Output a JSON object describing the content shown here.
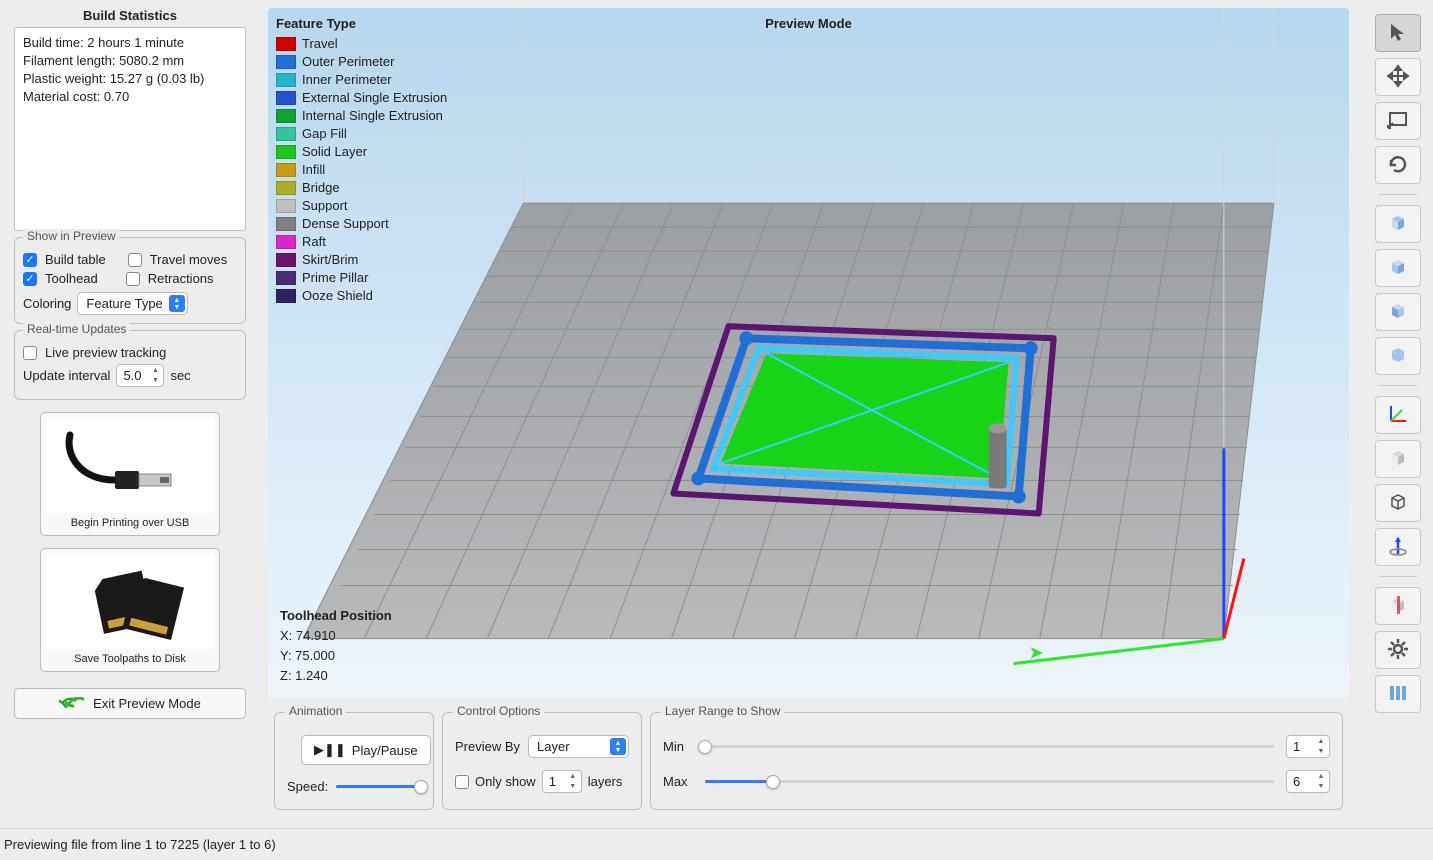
{
  "sidebar": {
    "title": "Build Statistics",
    "stats": {
      "build_time": "Build time: 2 hours 1 minute",
      "filament": "Filament length: 5080.2 mm",
      "weight": "Plastic weight: 15.27 g (0.03 lb)",
      "cost": "Material cost: 0.70"
    },
    "show_in_preview": {
      "legend": "Show in Preview",
      "build_table": {
        "label": "Build table",
        "checked": true
      },
      "travel": {
        "label": "Travel moves",
        "checked": false
      },
      "toolhead": {
        "label": "Toolhead",
        "checked": true
      },
      "retractions": {
        "label": "Retractions",
        "checked": false
      },
      "coloring_label": "Coloring",
      "coloring_value": "Feature Type"
    },
    "realtime": {
      "legend": "Real-time Updates",
      "live_preview": {
        "label": "Live preview tracking",
        "checked": false
      },
      "interval_label": "Update interval",
      "interval_value": "5.0",
      "interval_unit": "sec"
    },
    "usb_caption": "Begin Printing over USB",
    "disk_caption": "Save Toolpaths to Disk",
    "exit_label": "Exit Preview Mode"
  },
  "legend": {
    "title": "Feature Type",
    "items": [
      {
        "label": "Travel",
        "color": "#d40000"
      },
      {
        "label": "Outer Perimeter",
        "color": "#1f6fd6"
      },
      {
        "label": "Inner Perimeter",
        "color": "#25b4c8"
      },
      {
        "label": "External Single Extrusion",
        "color": "#2453c7"
      },
      {
        "label": "Internal Single Extrusion",
        "color": "#0aa33a"
      },
      {
        "label": "Gap Fill",
        "color": "#33c39e"
      },
      {
        "label": "Solid Layer",
        "color": "#1cc61c"
      },
      {
        "label": "Infill",
        "color": "#c79a15"
      },
      {
        "label": "Bridge",
        "color": "#a9ad29"
      },
      {
        "label": "Support",
        "color": "#bfbfbf"
      },
      {
        "label": "Dense Support",
        "color": "#808080"
      },
      {
        "label": "Raft",
        "color": "#d927c8"
      },
      {
        "label": "Skirt/Brim",
        "color": "#6a156a"
      },
      {
        "label": "Prime Pillar",
        "color": "#4a2c73"
      },
      {
        "label": "Ooze Shield",
        "color": "#2f2360"
      }
    ]
  },
  "viewport": {
    "title": "Preview Mode",
    "toolhead_title": "Toolhead Position",
    "toolhead_x": "X: 74.910",
    "toolhead_y": "Y: 75.000",
    "toolhead_z": "Z: 1.240"
  },
  "bottom": {
    "animation": {
      "legend": "Animation",
      "play_label": "Play/Pause",
      "speed_label": "Speed:",
      "speed_pct": 100
    },
    "control": {
      "legend": "Control Options",
      "preview_by_label": "Preview By",
      "preview_by_value": "Layer",
      "only_show_label": "Only show",
      "only_show_value": "1",
      "only_show_unit": "layers",
      "only_show_checked": false
    },
    "range": {
      "legend": "Layer Range to Show",
      "min_label": "Min",
      "min_value": "1",
      "min_pct": 0,
      "max_label": "Max",
      "max_value": "6",
      "max_pct": 12
    }
  },
  "toolbar": {
    "items": [
      {
        "name": "cursor-icon",
        "active": true
      },
      {
        "name": "move-icon"
      },
      {
        "name": "viewport-icon"
      },
      {
        "name": "rotate-icon"
      },
      {
        "sep": true
      },
      {
        "name": "view-top-icon"
      },
      {
        "name": "view-front-icon"
      },
      {
        "name": "view-side-icon"
      },
      {
        "name": "view-iso-icon"
      },
      {
        "sep": true
      },
      {
        "name": "axes-icon"
      },
      {
        "name": "solid-icon"
      },
      {
        "name": "wireframe-icon"
      },
      {
        "name": "normals-icon"
      },
      {
        "sep": true
      },
      {
        "name": "section-icon"
      },
      {
        "name": "gear-icon"
      },
      {
        "name": "columns-icon"
      }
    ]
  },
  "status": "Previewing file from line 1 to 7225 (layer 1 to 6)"
}
